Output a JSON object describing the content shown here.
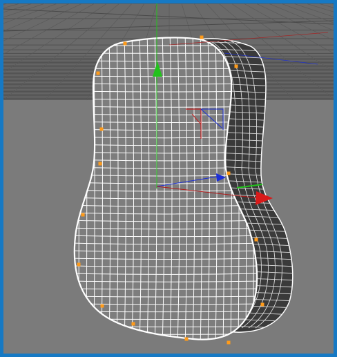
{
  "viewport": {
    "name": "3d-viewport",
    "frame_color": "#1679c4",
    "background_color": "#7b7b7b",
    "floor_color": "#6f6f6f"
  },
  "model": {
    "name": "guitar-body-mesh",
    "wire_color": "#ffffff",
    "side_color": "#3b3b3b"
  },
  "gizmo": {
    "x_axis_color": "#d91a1a",
    "y_axis_color": "#22c21c",
    "z_axis_color": "#1c2fd8"
  },
  "points": {
    "color": "#ff9b1a"
  }
}
